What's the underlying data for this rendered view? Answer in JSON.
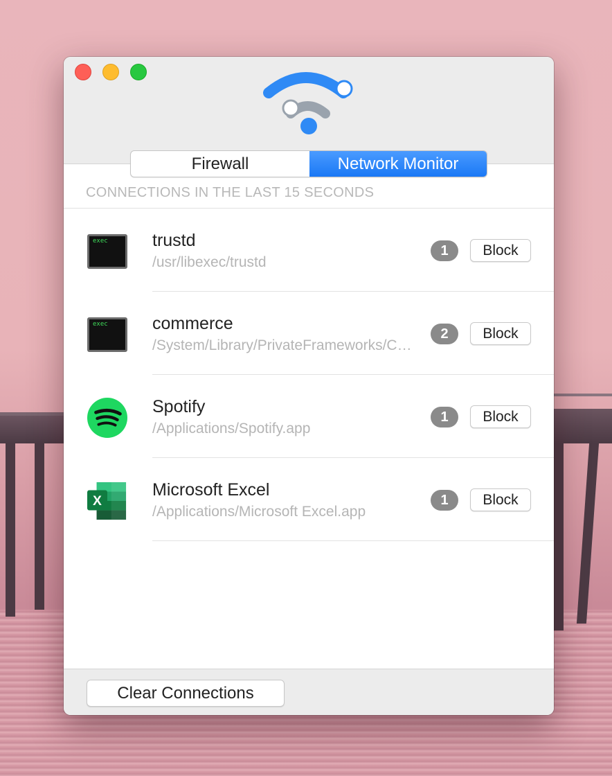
{
  "tabs": [
    {
      "label": "Firewall",
      "active": false
    },
    {
      "label": "Network Monitor",
      "active": true
    }
  ],
  "section_header": "CONNECTIONS IN THE LAST 15 SECONDS",
  "connections": [
    {
      "name": "trustd",
      "path": "/usr/libexec/trustd",
      "count": "1",
      "icon": "exec-terminal-icon",
      "icon_label": "exec",
      "action": "Block"
    },
    {
      "name": "commerce",
      "path": "/System/Library/PrivateFrameworks/CommerceKit.framework/Versions/A/Resources/commerce",
      "count": "2",
      "icon": "exec-terminal-icon",
      "icon_label": "exec",
      "action": "Block"
    },
    {
      "name": "Spotify",
      "path": "/Applications/Spotify.app",
      "count": "1",
      "icon": "spotify-icon",
      "action": "Block"
    },
    {
      "name": "Microsoft Excel",
      "path": "/Applications/Microsoft Excel.app",
      "count": "1",
      "icon": "excel-icon",
      "icon_label": "X",
      "action": "Block"
    }
  ],
  "footer": {
    "clear_label": "Clear Connections"
  },
  "colors": {
    "accent": "#1a78f5",
    "logo_grey": "#9aa3ad",
    "badge": "#8a8a8a",
    "spotify_green": "#1ed760",
    "excel_green": "#1d6f42"
  }
}
